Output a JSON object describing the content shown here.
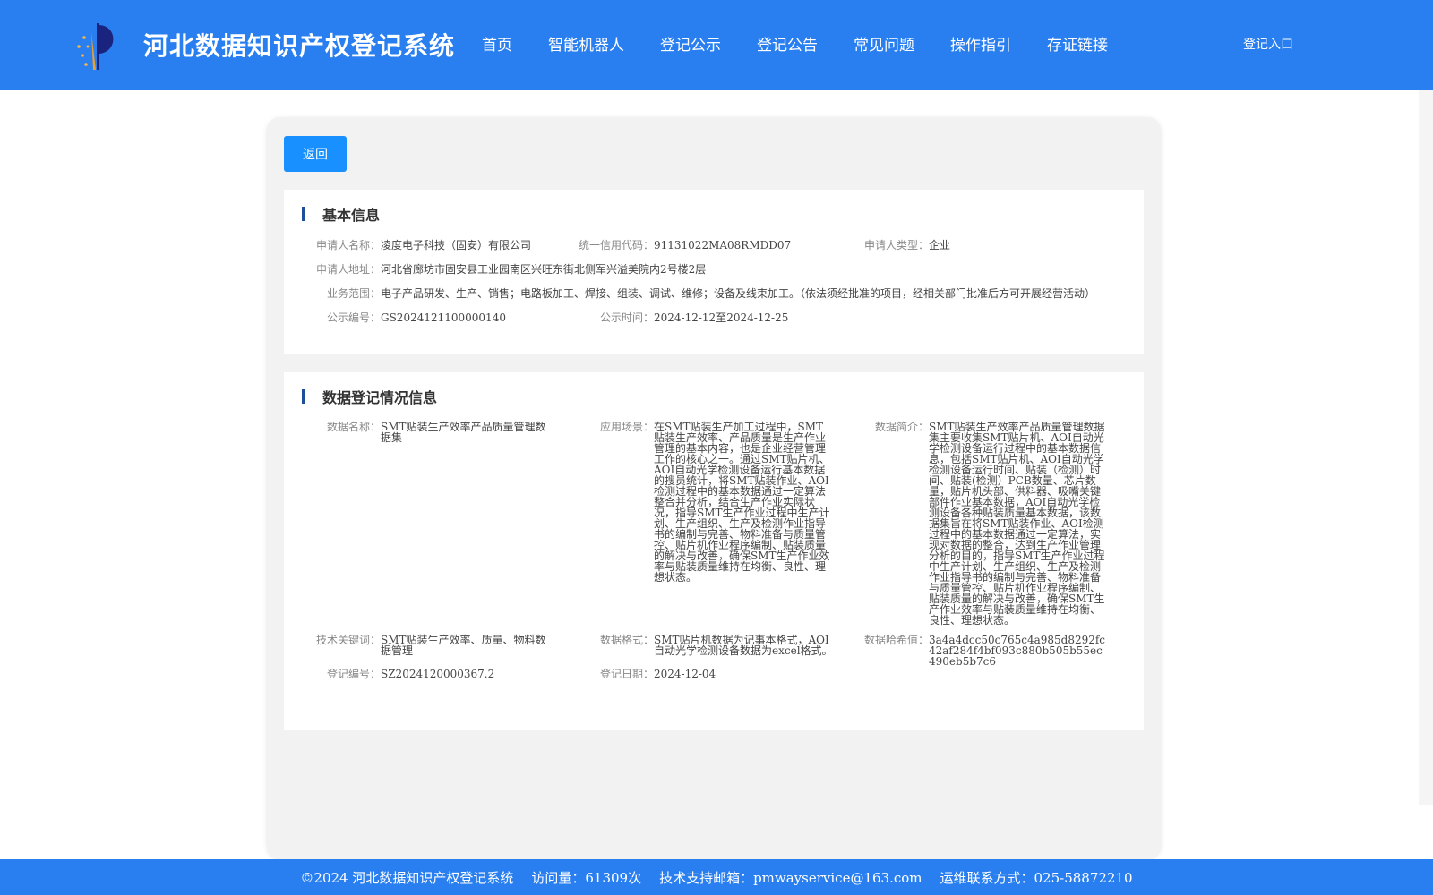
{
  "header": {
    "title": "河北数据知识产权登记系统",
    "nav": [
      "首页",
      "智能机器人",
      "登记公示",
      "登记公告",
      "常见问题",
      "操作指引",
      "存证链接"
    ],
    "login": "登记入口",
    "logo_icon": "torch-stars-logo-icon",
    "bg_color": "#2a7ff0"
  },
  "back_button": "返回",
  "basic": {
    "title": "基本信息",
    "applicant_name_label": "申请人名称：",
    "applicant_name": "凌度电子科技（固安）有限公司",
    "credit_code_label": "统一信用代码：",
    "credit_code": "91131022MA08RMDD07",
    "applicant_type_label": "申请人类型：",
    "applicant_type": "企业",
    "address_label": "申请人地址：",
    "address": "河北省廊坊市固安县工业园南区兴旺东街北侧军兴溢美院内2号楼2层",
    "scope_label": "业务范围：",
    "scope": "电子产品研发、生产、销售；电路板加工、焊接、组装、调试、维修；设备及线束加工。（依法须经批准的项目，经相关部门批准后方可开展经营活动）",
    "pub_no_label": "公示编号：",
    "pub_no": "GS2024121100000140",
    "pub_time_label": "公示时间：",
    "pub_time": "2024-12-12至2024-12-25"
  },
  "data": {
    "title": "数据登记情况信息",
    "name_label": "数据名称：",
    "name": "SMT贴装生产效率产品质量管理数据集",
    "scene_label": "应用场景：",
    "scene": "在SMT贴装生产加工过程中，SMT贴装生产效率、产品质量是生产作业管理的基本内容，也是企业经营管理工作的核心之一。通过SMT贴片机、AOI自动光学检测设备运行基本数据的搜员统计，将SMT贴装作业、AOI检测过程中的基本数据通过一定算法整合并分析，结合生产作业实际状况，指导SMT生产作业过程中生产计划、生产组织、生产及检测作业指导书的编制与完善、物料准备与质量管控、贴片机作业程序编制、贴装质量的解决与改善，确保SMT生产作业效率与贴装质量维持在均衡、良性、理想状态。",
    "intro_label": "数据简介：",
    "intro": "SMT贴装生产效率产品质量管理数据集主要收集SMT贴片机、AOI自动光学检测设备运行过程中的基本数据信息，包括SMT贴片机、AOI自动光学检测设备运行时间、贴装（检测）时间、贴装(检测）PCB数量、芯片数量，贴片机头部、供料器、吸嘴关键部件作业基本数据，AOI自动光学检测设备各种贴装质量基本数据，该数据集旨在将SMT贴装作业、AOI检测过程中的基本数据通过一定算法，实现对数据的整合，达到生产作业管理分析的目的，指导SMT生产作业过程中生产计划、生产组织、生产及检测作业指导书的编制与完善、物料准备与质量管控、贴片机作业程序编制、贴装质量的解决与改善，确保SMT生产作业效率与贴装质量维持在均衡、良性、理想状态。",
    "keywords_label": "技术关键词：",
    "keywords": "SMT贴装生产效率、质量、物料数据管理",
    "format_label": "数据格式：",
    "format": "SMT贴片机数据为记事本格式，AOI自动光学检测设备数据为excel格式。",
    "hash_label": "数据哈希值：",
    "hash": "3a4a4dcc50c765c4a985d8292fc42af284f4bf093c880b505b55ec490eb5b7c6",
    "reg_no_label": "登记编号：",
    "reg_no": "SZ2024120000367.2",
    "reg_date_label": "登记日期：",
    "reg_date": "2024-12-04"
  },
  "footer": {
    "copyright": "©2024 河北数据知识产权登记系统",
    "visits": "访问量：61309次",
    "email": "技术支持邮箱：pmwayservice@163.com",
    "phone": "运维联系方式：025-58872210"
  }
}
